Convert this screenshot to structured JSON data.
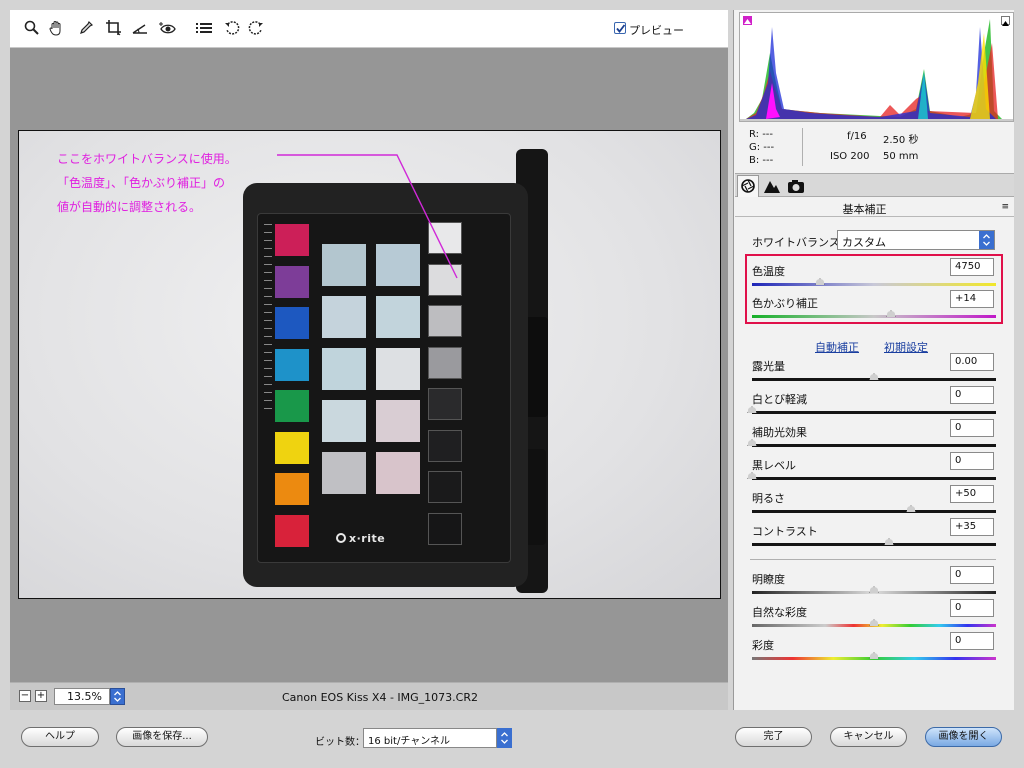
{
  "toolbar": {
    "tools": [
      "zoom-icon",
      "hand-icon",
      "white-balance-eyedropper-icon",
      "crop-icon",
      "straighten-icon",
      "red-eye-icon",
      "preferences-icon",
      "rotate-left-icon",
      "rotate-right-icon"
    ],
    "preview_label": "プレビュー",
    "preview_checked": true
  },
  "annotation": {
    "line1": "ここをホワイトバランスに使用。",
    "line2": "「色温度」、「色かぶり補正」の",
    "line3": "値が自動的に調整される。",
    "color": "#e020e0"
  },
  "status": {
    "zoom": "13.5%",
    "filename": "Canon EOS Kiss X4  -  IMG_1073.CR2"
  },
  "info": {
    "r": "R:  ---",
    "g": "G:  ---",
    "b": "B:  ---",
    "aperture": "f/16",
    "shutter": "2.50 秒",
    "iso": "ISO 200",
    "focal": "50 mm"
  },
  "panel": {
    "title": "基本補正",
    "wb_label": "ホワイトバランス：",
    "wb_value": "カスタム",
    "auto": "自動補正",
    "default": "初期設定",
    "temp": {
      "label": "色温度",
      "value": "4750",
      "level": 0.28
    },
    "tint": {
      "label": "色かぶり補正",
      "value": "+14",
      "level": 0.57
    },
    "sliders": [
      {
        "label": "露光量",
        "value": "0.00",
        "level": 0.5
      },
      {
        "label": "白とび軽減",
        "value": "0",
        "level": 0.0
      },
      {
        "label": "補助光効果",
        "value": "0",
        "level": 0.0
      },
      {
        "label": "黒レベル",
        "value": "0",
        "level": 0.0
      },
      {
        "label": "明るさ",
        "value": "+50",
        "level": 0.65
      },
      {
        "label": "コントラスト",
        "value": "+35",
        "level": 0.56
      }
    ],
    "sliders2": [
      {
        "label": "明瞭度",
        "value": "0",
        "level": 0.5
      },
      {
        "label": "自然な彩度",
        "value": "0",
        "level": 0.5
      },
      {
        "label": "彩度",
        "value": "0",
        "level": 0.5
      }
    ]
  },
  "bottom": {
    "help": "ヘルプ",
    "save": "画像を保存...",
    "depth_label": "ビット数：",
    "depth_value": "16 bit/チャンネル",
    "done": "完了",
    "cancel": "キャンセル",
    "open": "画像を開く"
  },
  "card": {
    "brand": "x·rite",
    "swatches": [
      "#cc1f58",
      "#7d3d98",
      "#1d58c0",
      "#1e92c9",
      "#19984a",
      "#efd310",
      "#ec8a10",
      "#d8223a"
    ]
  }
}
